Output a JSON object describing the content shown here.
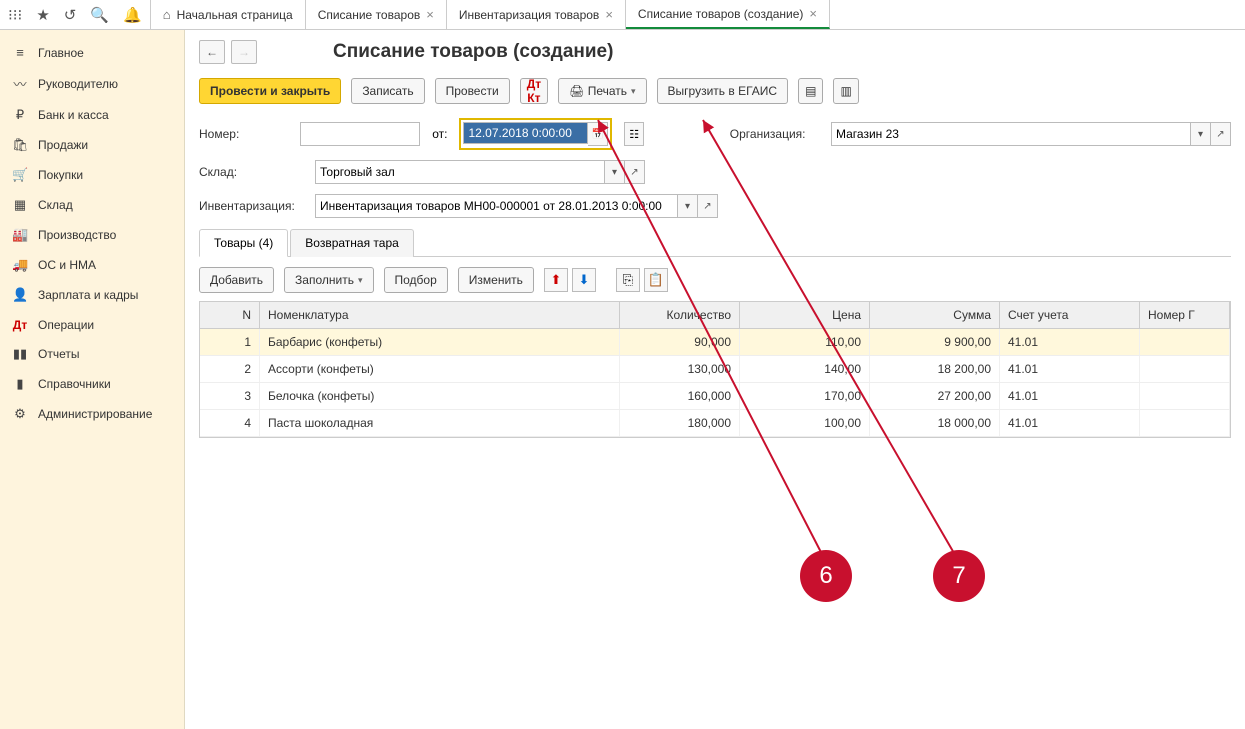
{
  "topbar": {
    "tabs": [
      {
        "label": "Начальная страница",
        "closable": false,
        "home": true
      },
      {
        "label": "Списание товаров",
        "closable": true
      },
      {
        "label": "Инвентаризация товаров",
        "closable": true
      },
      {
        "label": "Списание товаров (создание)",
        "closable": true,
        "active": true
      }
    ]
  },
  "sidebar": {
    "items": [
      {
        "icon": "≡",
        "label": "Главное"
      },
      {
        "icon": "📈",
        "label": "Руководителю"
      },
      {
        "icon": "₽",
        "label": "Банк и касса"
      },
      {
        "icon": "🛍",
        "label": "Продажи"
      },
      {
        "icon": "🛒",
        "label": "Покупки"
      },
      {
        "icon": "▦",
        "label": "Склад"
      },
      {
        "icon": "🏭",
        "label": "Производство"
      },
      {
        "icon": "🚚",
        "label": "ОС и НМА"
      },
      {
        "icon": "👤",
        "label": "Зарплата и кадры"
      },
      {
        "icon": "Дт",
        "label": "Операции"
      },
      {
        "icon": "📊",
        "label": "Отчеты"
      },
      {
        "icon": "📚",
        "label": "Справочники"
      },
      {
        "icon": "⚙",
        "label": "Администрирование"
      }
    ]
  },
  "page": {
    "title": "Списание товаров (создание)"
  },
  "toolbar": {
    "post_close": "Провести и закрыть",
    "record": "Записать",
    "post": "Провести",
    "print": "Печать",
    "egais": "Выгрузить в ЕГАИС"
  },
  "form": {
    "number_label": "Номер:",
    "number_value": "",
    "from_label": "от:",
    "date_value": "12.07.2018 0:00:00",
    "org_label": "Организация:",
    "org_value": "Магазин 23",
    "warehouse_label": "Склад:",
    "warehouse_value": "Торговый зал",
    "inventory_label": "Инвентаризация:",
    "inventory_value": "Инвентаризация товаров МН00-000001 от 28.01.2013 0:00:00"
  },
  "doc_tabs": {
    "goods": "Товары (4)",
    "return": "Возвратная тара"
  },
  "sub_toolbar": {
    "add": "Добавить",
    "fill": "Заполнить",
    "pick": "Подбор",
    "edit": "Изменить"
  },
  "grid": {
    "headers": {
      "n": "N",
      "nom": "Номенклатура",
      "qty": "Количество",
      "price": "Цена",
      "sum": "Сумма",
      "acc": "Счет учета",
      "gtd": "Номер Г"
    },
    "rows": [
      {
        "n": "1",
        "nom": "Барбарис (конфеты)",
        "qty": "90,000",
        "price": "110,00",
        "sum": "9 900,00",
        "acc": "41.01"
      },
      {
        "n": "2",
        "nom": "Ассорти (конфеты)",
        "qty": "130,000",
        "price": "140,00",
        "sum": "18 200,00",
        "acc": "41.01"
      },
      {
        "n": "3",
        "nom": "Белочка (конфеты)",
        "qty": "160,000",
        "price": "170,00",
        "sum": "27 200,00",
        "acc": "41.01"
      },
      {
        "n": "4",
        "nom": "Паста шоколадная",
        "qty": "180,000",
        "price": "100,00",
        "sum": "18 000,00",
        "acc": "41.01"
      }
    ]
  },
  "callouts": {
    "c6": "6",
    "c7": "7"
  }
}
